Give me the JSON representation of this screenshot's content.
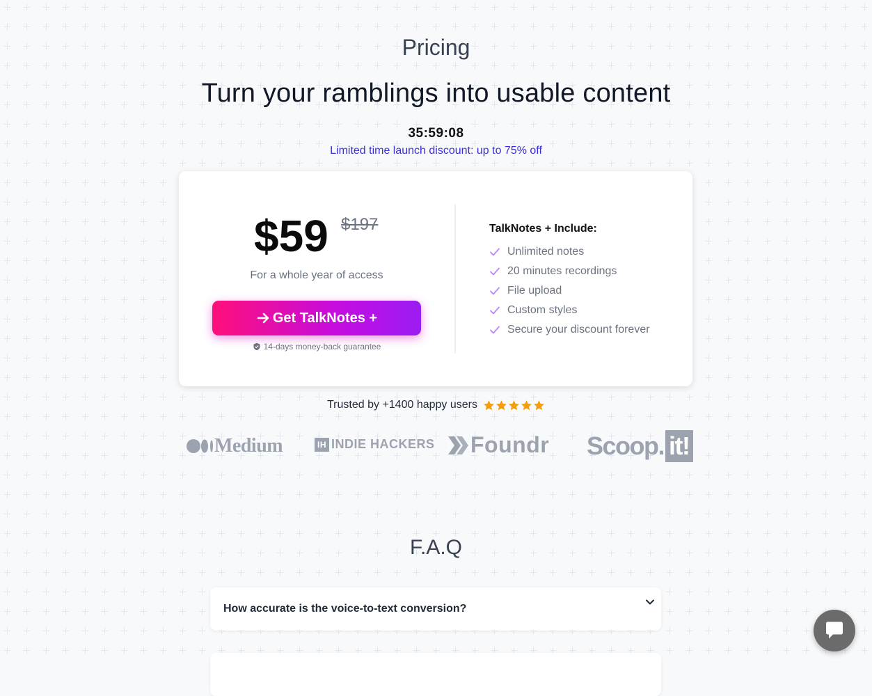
{
  "header": {
    "eyebrow": "Pricing",
    "headline": "Turn your ramblings into usable content",
    "countdown": "35:59:08",
    "discount": "Limited time launch discount: up to 75% off"
  },
  "pricing_card": {
    "price": "$59",
    "old_price": "$197",
    "access_note": "For a whole year of access",
    "cta_label": "Get TalkNotes +",
    "guarantee": "14-days money-back guarantee",
    "features_title": "TalkNotes + Include:",
    "features": [
      "Unlimited notes",
      "20 minutes recordings",
      "File upload",
      "Custom styles",
      "Secure your discount forever"
    ]
  },
  "social_proof": {
    "trusted_text": "Trusted by +1400 happy users",
    "rating": 5,
    "star_color": "#f59e0b"
  },
  "logos": {
    "medium": "Medium",
    "indie_hackers_box": "IH",
    "indie_hackers": "INDIE HACKERS",
    "foundr": "Foundr",
    "scoop": "Scoop.",
    "scoop_it": "it!"
  },
  "faq": {
    "title": "F.A.Q",
    "items": [
      {
        "question": "How accurate is the voice-to-text conversion?"
      }
    ]
  },
  "colors": {
    "accent_start": "#ff0f7b",
    "accent_end": "#9b1cf2",
    "discount_text": "#3b2fd6",
    "check_color": "#c084fc"
  }
}
